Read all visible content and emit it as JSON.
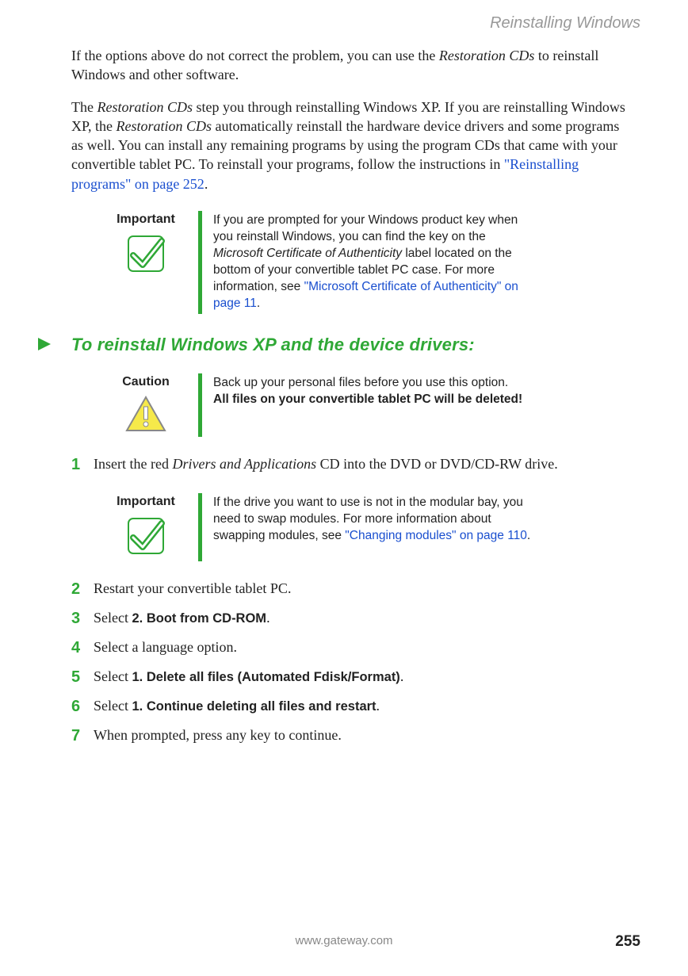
{
  "header": "Reinstalling Windows",
  "para1": {
    "t1": "If the options above do not correct the problem, you can use the ",
    "i1": "Restoration CDs",
    "t2": " to reinstall Windows and other software."
  },
  "para2": {
    "t1": "The ",
    "i1": "Restoration CDs",
    "t2": " step you through reinstalling Windows XP. If you are reinstalling Windows XP, the ",
    "i2": "Restoration CDs",
    "t3": " automatically reinstall the hardware device drivers and some programs as well. You can install any remaining programs by using the program CDs that came with your convertible tablet PC. To reinstall your programs, follow the instructions in ",
    "l1": "\"Reinstalling programs\" on page 252",
    "t4": "."
  },
  "note1": {
    "label": "Important",
    "t1": "If you are prompted for your Windows product key when you reinstall Windows, you can find the key on the ",
    "i1": "Microsoft Certificate of Authenticity",
    "t2": " label located on the bottom of your convertible tablet PC case. For more information, see ",
    "l1": "\"Microsoft Certificate of Authenticity\" on page 11",
    "t3": "."
  },
  "taskHeading": "To reinstall Windows XP and the device drivers:",
  "caution": {
    "label": "Caution",
    "t1": "Back up your personal files before you use this option.",
    "b1": "All files on your convertible tablet PC will be deleted!"
  },
  "step1": {
    "num": "1",
    "t1": "Insert the red ",
    "i1": "Drivers and Applications",
    "t2": " CD into the DVD or DVD/CD-RW drive."
  },
  "note2": {
    "label": "Important",
    "t1": "If the drive you want to use is not in the modular bay, you need to swap modules. For more information about swapping modules, see ",
    "l1": "\"Changing modules\" on page 110",
    "t2": "."
  },
  "step2": {
    "num": "2",
    "t1": "Restart your convertible tablet PC."
  },
  "step3": {
    "num": "3",
    "t1": "Select ",
    "b1": "2. Boot from CD-ROM",
    "t2": "."
  },
  "step4": {
    "num": "4",
    "t1": "Select a language option."
  },
  "step5": {
    "num": "5",
    "t1": "Select ",
    "b1": "1. Delete all files (Automated Fdisk/Format)",
    "t2": "."
  },
  "step6": {
    "num": "6",
    "t1": "Select ",
    "b1": "1. Continue deleting all files and restart",
    "t2": "."
  },
  "step7": {
    "num": "7",
    "t1": "When prompted, press any key to continue."
  },
  "footer": "www.gateway.com",
  "pageNum": "255"
}
